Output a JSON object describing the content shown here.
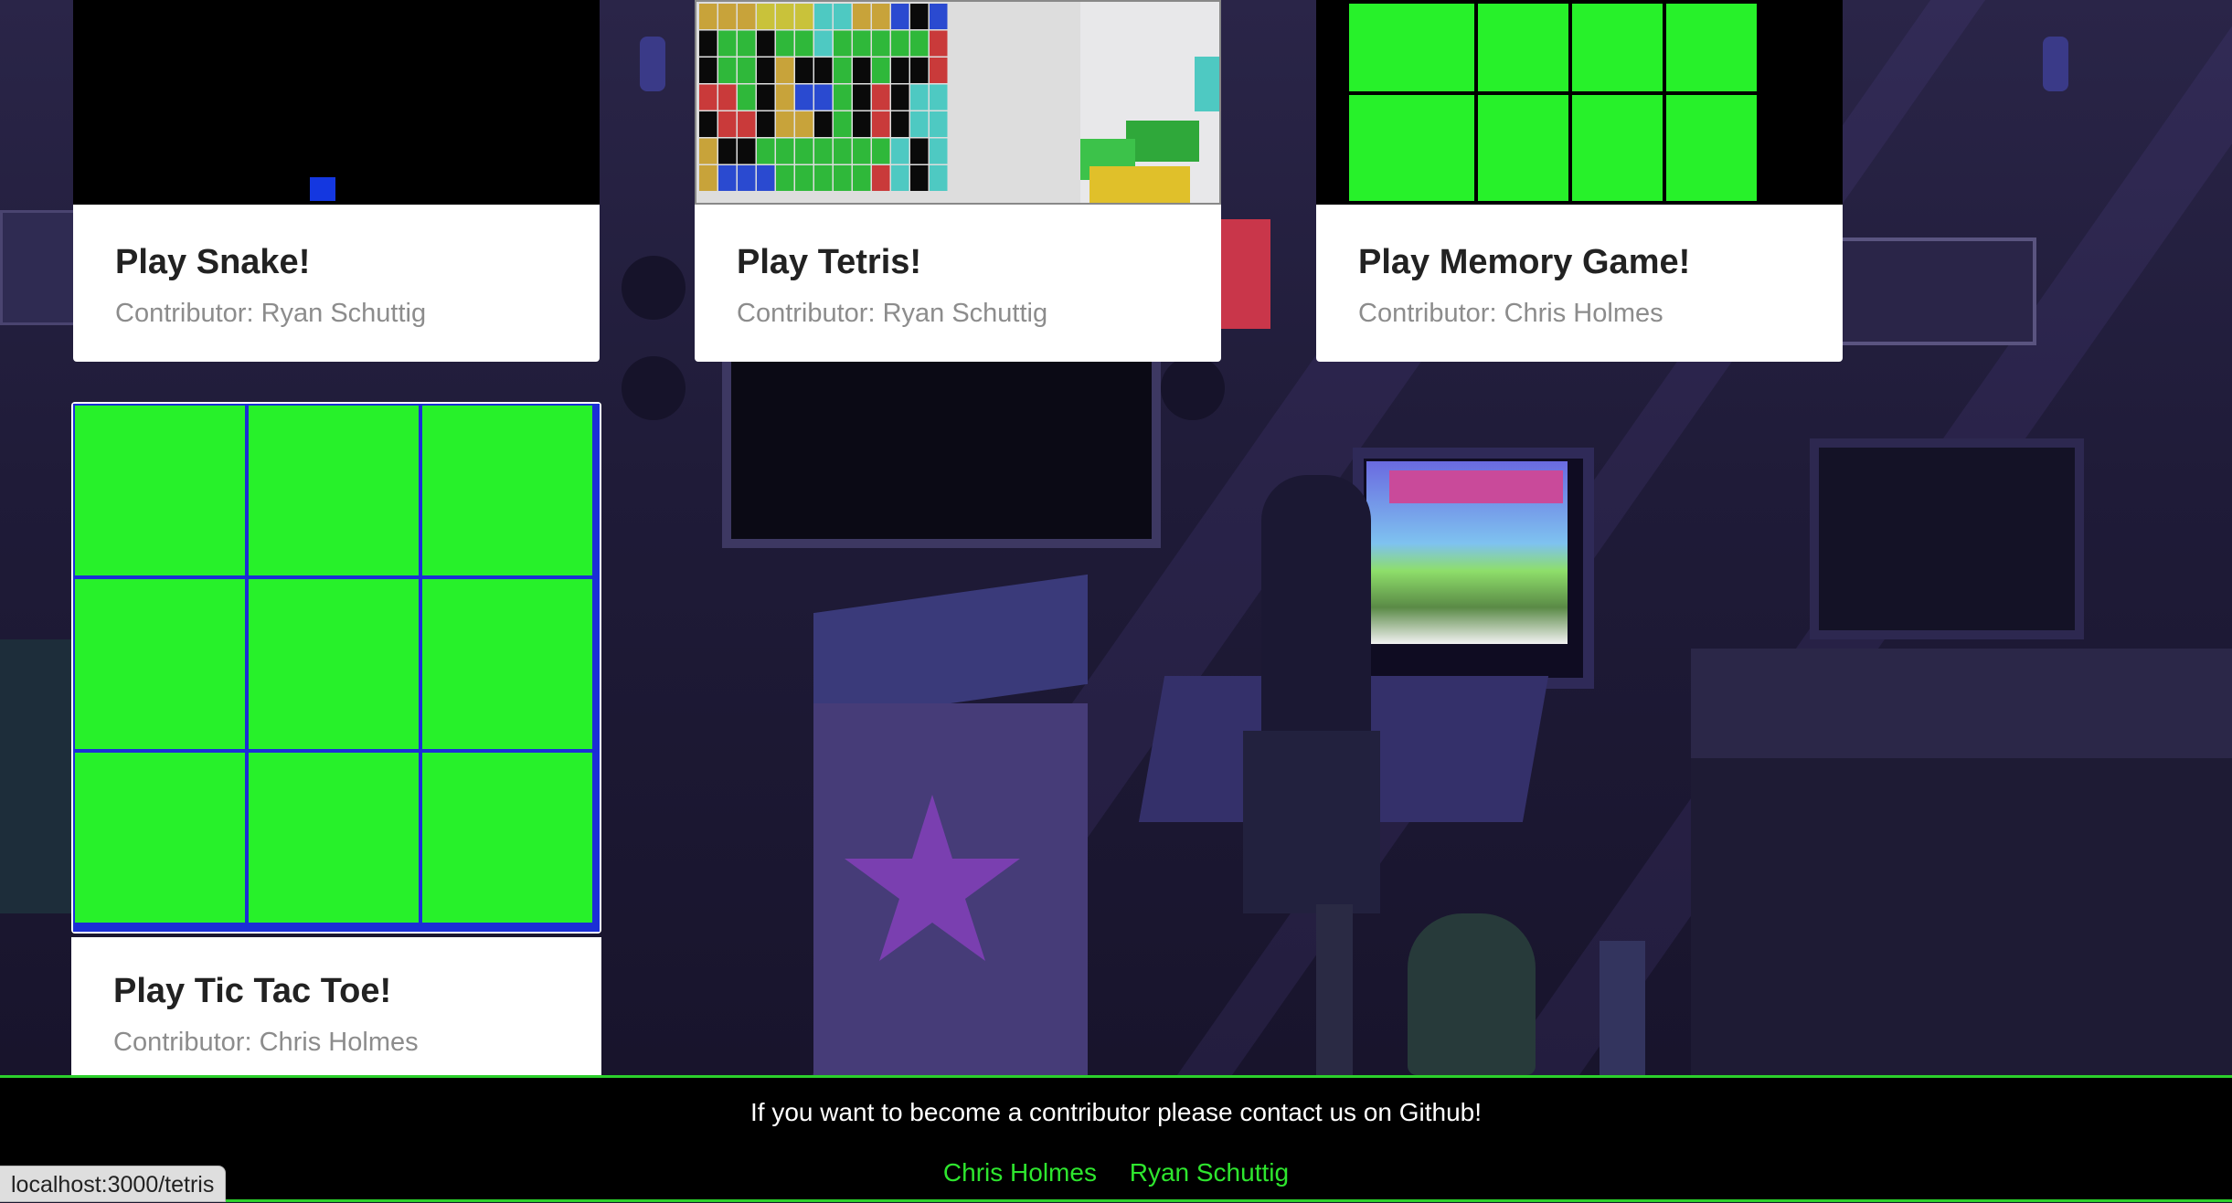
{
  "cards": [
    {
      "title": "Play Snake!",
      "contributor": "Contributor: Ryan Schuttig"
    },
    {
      "title": "Play Tetris!",
      "contributor": "Contributor: Ryan Schuttig"
    },
    {
      "title": "Play Memory Game!",
      "contributor": "Contributor: Chris Holmes"
    },
    {
      "title": "Play Tic Tac Toe!",
      "contributor": "Contributor: Chris Holmes"
    }
  ],
  "footer": {
    "message": "If you want to become a contributor please contact us on Github!",
    "links": [
      "Chris Holmes",
      "Ryan Schuttig"
    ]
  },
  "status_url": "localhost:3000/tetris",
  "colors": {
    "game_green": "#27f12a",
    "grid_blue": "#1b2fd6",
    "link_green": "#2ee62e",
    "snake_blue": "#1437e0"
  }
}
